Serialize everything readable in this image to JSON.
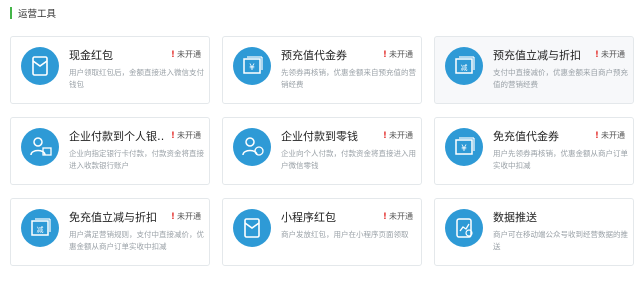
{
  "section": {
    "title": "运营工具"
  },
  "colors": {
    "accent": "#44b549",
    "icon_bg": "#2e9ad6",
    "status_mark": "#e64340"
  },
  "cards": [
    {
      "title": "现金红包",
      "status_mark": "!",
      "status": "未开通",
      "desc": "用户领取红包后，金额直接进入微信支付钱包",
      "icon": "red-envelope-icon"
    },
    {
      "title": "预充值代金券",
      "status_mark": "!",
      "status": "未开通",
      "desc": "先领券再核销，优惠金额来自预充值的营销经费",
      "icon": "yen-voucher-icon"
    },
    {
      "title": "预充值立减与折扣",
      "status_mark": "!",
      "status": "未开通",
      "desc": "支付中直接减价，优惠金额来自商户预充值的营销经费",
      "icon": "discount-tag-icon"
    },
    {
      "title": "企业付款到个人银…",
      "status_mark": "!",
      "status": "未开通",
      "desc": "企业向指定银行卡付款，付款资金将直接进入收款银行账户",
      "icon": "bank-card-transfer-icon"
    },
    {
      "title": "企业付款到零钱",
      "status_mark": "!",
      "status": "未开通",
      "desc": "企业向个人付款，付款资金将直接进入用户微信零钱",
      "icon": "user-payment-icon"
    },
    {
      "title": "免充值代金券",
      "status_mark": "!",
      "status": "未开通",
      "desc": "用户先领券再核销，优惠金额从商户订单实收中扣减",
      "icon": "yen-voucher-icon"
    },
    {
      "title": "免充值立减与折扣",
      "status_mark": "!",
      "status": "未开通",
      "desc": "用户满足营销规则，支付中直接减价，优惠金额从商户订单实收中扣减",
      "icon": "discount-tag-icon"
    },
    {
      "title": "小程序红包",
      "status_mark": "!",
      "status": "未开通",
      "desc": "商户发放红包，用户在小程序页面领取",
      "icon": "red-envelope-icon"
    },
    {
      "title": "数据推送",
      "status_mark": "",
      "status": "",
      "desc": "商户可在移动端公众号收到经营数据的推送",
      "icon": "data-push-icon"
    }
  ]
}
